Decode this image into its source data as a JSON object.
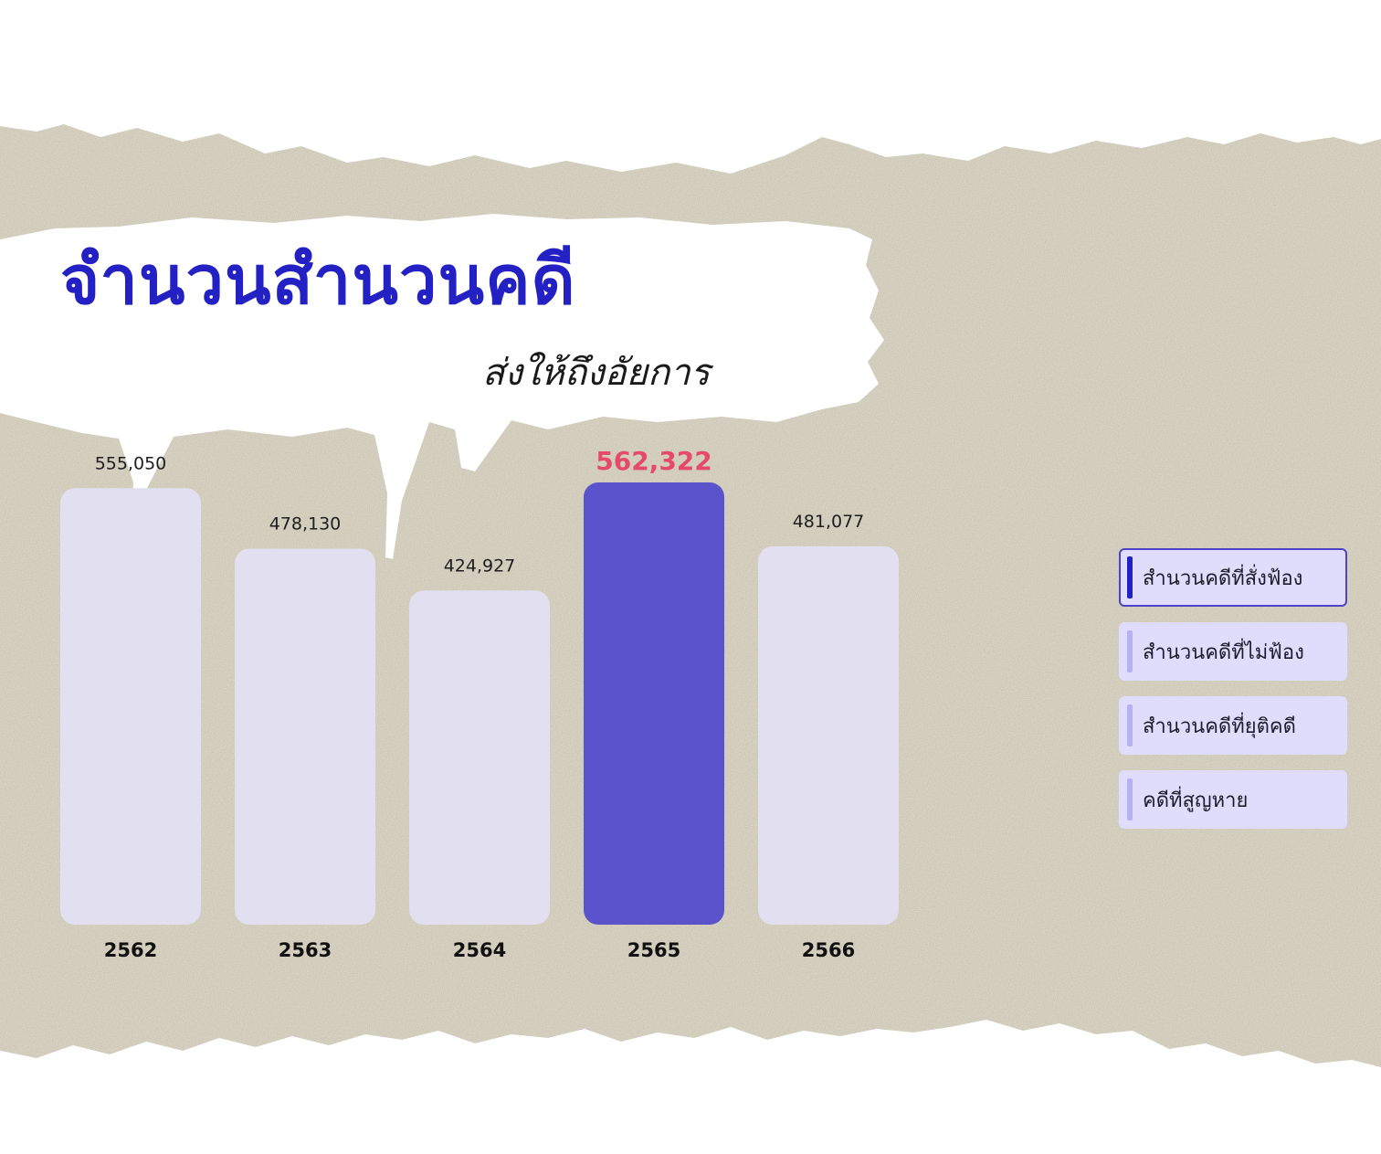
{
  "title": "จำนวนสำนวนคดี",
  "subtitle": "ส่งให้ถึงอัยการ",
  "colors": {
    "title": "#2320c4",
    "bar_default": "#e1dff0",
    "bar_highlight": "#5a53cb",
    "highlight_value": "#e64a6a",
    "legend_bg": "#e0dcfb",
    "legend_active_marker": "#2320c4",
    "legend_inactive_marker": "#b6b1f3",
    "paper": "#d8d3c2"
  },
  "legend": {
    "items": [
      {
        "label": "สำนวนคดีที่สั่งฟ้อง",
        "active": true
      },
      {
        "label": "สำนวนคดีที่ไม่ฟ้อง",
        "active": false
      },
      {
        "label": "สำนวนคดีที่ยุติคดี",
        "active": false
      },
      {
        "label": "คดีที่สูญหาย",
        "active": false
      }
    ]
  },
  "chart_data": {
    "type": "bar",
    "categories": [
      "2562",
      "2563",
      "2564",
      "2565",
      "2566"
    ],
    "values": [
      555050,
      478130,
      424927,
      562322,
      481077
    ],
    "value_labels": [
      "555,050",
      "478,130",
      "424,927",
      "562,322",
      "481,077"
    ],
    "highlight_index": 3,
    "ylim": [
      0,
      562322
    ],
    "grid": false
  }
}
